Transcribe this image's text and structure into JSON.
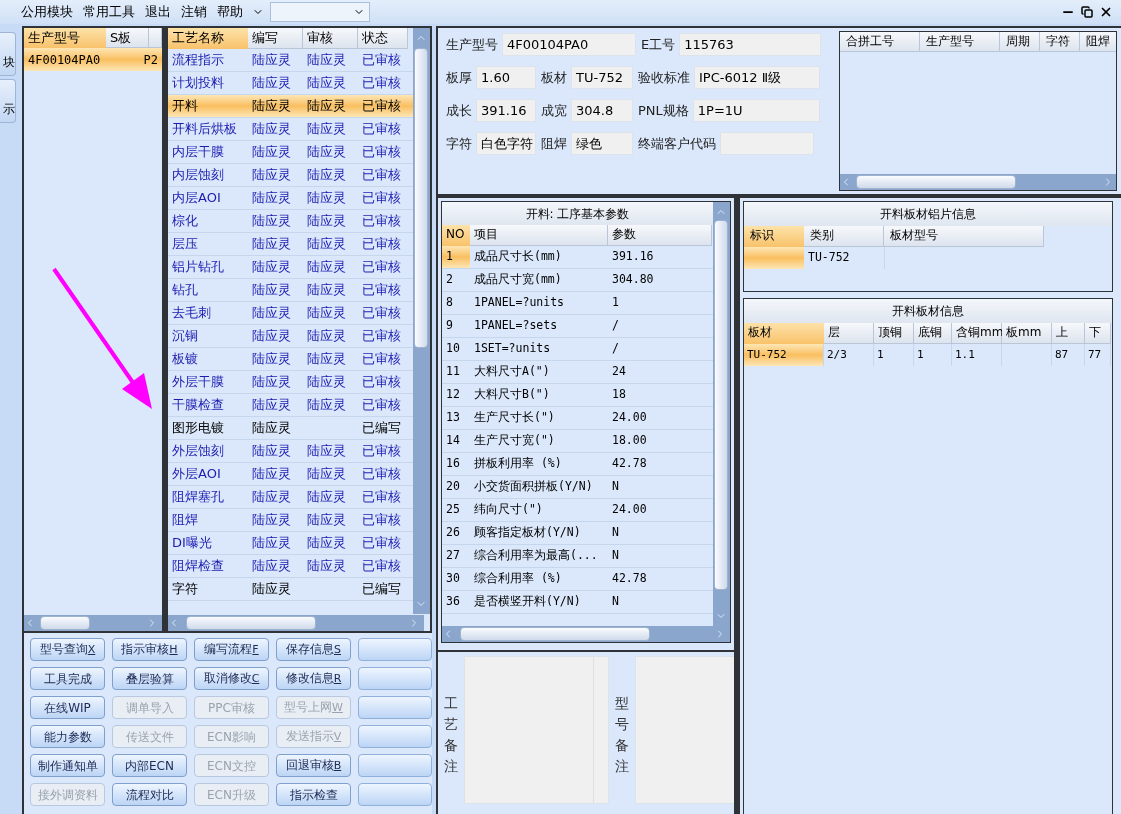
{
  "menu": {
    "items": [
      "公用模块",
      "常用工具",
      "退出",
      "注销",
      "帮助"
    ]
  },
  "left_strip": [
    "块",
    "示"
  ],
  "model_grid": {
    "columns": [
      "生产型号",
      "S板"
    ],
    "rows": [
      {
        "cells": [
          "4F00104PA0",
          "P2"
        ],
        "selected": true
      }
    ]
  },
  "process_table": {
    "columns": [
      "工艺名称",
      "编写",
      "审核",
      "状态"
    ],
    "rows": [
      {
        "name": "流程指示",
        "writer": "陆应灵",
        "reviewer": "陆应灵",
        "status": "已审核",
        "approved": true,
        "selected": false
      },
      {
        "name": "计划投料",
        "writer": "陆应灵",
        "reviewer": "陆应灵",
        "status": "已审核",
        "approved": true,
        "selected": false
      },
      {
        "name": "开料",
        "writer": "陆应灵",
        "reviewer": "陆应灵",
        "status": "已审核",
        "approved": true,
        "selected": true
      },
      {
        "name": "开料后烘板",
        "writer": "陆应灵",
        "reviewer": "陆应灵",
        "status": "已审核",
        "approved": true,
        "selected": false
      },
      {
        "name": "内层干膜",
        "writer": "陆应灵",
        "reviewer": "陆应灵",
        "status": "已审核",
        "approved": true,
        "selected": false
      },
      {
        "name": "内层蚀刻",
        "writer": "陆应灵",
        "reviewer": "陆应灵",
        "status": "已审核",
        "approved": true,
        "selected": false
      },
      {
        "name": "内层AOI",
        "writer": "陆应灵",
        "reviewer": "陆应灵",
        "status": "已审核",
        "approved": true,
        "selected": false
      },
      {
        "name": "棕化",
        "writer": "陆应灵",
        "reviewer": "陆应灵",
        "status": "已审核",
        "approved": true,
        "selected": false
      },
      {
        "name": "层压",
        "writer": "陆应灵",
        "reviewer": "陆应灵",
        "status": "已审核",
        "approved": true,
        "selected": false
      },
      {
        "name": "铝片钻孔",
        "writer": "陆应灵",
        "reviewer": "陆应灵",
        "status": "已审核",
        "approved": true,
        "selected": false
      },
      {
        "name": "钻孔",
        "writer": "陆应灵",
        "reviewer": "陆应灵",
        "status": "已审核",
        "approved": true,
        "selected": false
      },
      {
        "name": "去毛刺",
        "writer": "陆应灵",
        "reviewer": "陆应灵",
        "status": "已审核",
        "approved": true,
        "selected": false
      },
      {
        "name": "沉铜",
        "writer": "陆应灵",
        "reviewer": "陆应灵",
        "status": "已审核",
        "approved": true,
        "selected": false
      },
      {
        "name": "板镀",
        "writer": "陆应灵",
        "reviewer": "陆应灵",
        "status": "已审核",
        "approved": true,
        "selected": false
      },
      {
        "name": "外层干膜",
        "writer": "陆应灵",
        "reviewer": "陆应灵",
        "status": "已审核",
        "approved": true,
        "selected": false
      },
      {
        "name": "干膜检查",
        "writer": "陆应灵",
        "reviewer": "陆应灵",
        "status": "已审核",
        "approved": true,
        "selected": false
      },
      {
        "name": "图形电镀",
        "writer": "陆应灵",
        "status": "已编写",
        "approved": false,
        "selected": false
      },
      {
        "name": "外层蚀刻",
        "writer": "陆应灵",
        "reviewer": "陆应灵",
        "status": "已审核",
        "approved": true,
        "selected": false
      },
      {
        "name": "外层AOI",
        "writer": "陆应灵",
        "reviewer": "陆应灵",
        "status": "已审核",
        "approved": true,
        "selected": false
      },
      {
        "name": "阻焊塞孔",
        "writer": "陆应灵",
        "reviewer": "陆应灵",
        "status": "已审核",
        "approved": true,
        "selected": false
      },
      {
        "name": "阻焊",
        "writer": "陆应灵",
        "reviewer": "陆应灵",
        "status": "已审核",
        "approved": true,
        "selected": false
      },
      {
        "name": "DI曝光",
        "writer": "陆应灵",
        "reviewer": "陆应灵",
        "status": "已审核",
        "approved": true,
        "selected": false
      },
      {
        "name": "阻焊检查",
        "writer": "陆应灵",
        "reviewer": "陆应灵",
        "status": "已审核",
        "approved": true,
        "selected": false
      },
      {
        "name": "字符",
        "writer": "陆应灵",
        "status": "已编写",
        "approved": false,
        "selected": false
      }
    ]
  },
  "buttons": [
    [
      {
        "label": "型号查询",
        "shortcut": "X",
        "disabled": false
      },
      {
        "label": "指示审核",
        "shortcut": "H",
        "disabled": false
      },
      {
        "label": "编写流程",
        "shortcut": "F",
        "disabled": false
      },
      {
        "label": "保存信息",
        "shortcut": "S",
        "disabled": false
      },
      {
        "kind": "blank"
      }
    ],
    [
      {
        "label": "工具完成",
        "disabled": false
      },
      {
        "label": "叠层验算",
        "disabled": false
      },
      {
        "label": "取消修改",
        "shortcut": "C",
        "disabled": false
      },
      {
        "label": "修改信息",
        "shortcut": "R",
        "disabled": false
      },
      {
        "kind": "blank"
      }
    ],
    [
      {
        "label": "在线WIP",
        "disabled": false
      },
      {
        "label": "调单导入",
        "disabled": true
      },
      {
        "label": "PPC审核",
        "disabled": true
      },
      {
        "label": "型号上网",
        "shortcut": "W",
        "disabled": true
      },
      {
        "kind": "blank"
      }
    ],
    [
      {
        "label": "能力参数",
        "disabled": false
      },
      {
        "label": "传送文件",
        "disabled": true
      },
      {
        "label": "ECN影响",
        "disabled": true
      },
      {
        "label": "发送指示",
        "shortcut": "V",
        "disabled": true
      },
      {
        "kind": "blank"
      }
    ],
    [
      {
        "label": "制作通知单",
        "disabled": false
      },
      {
        "label": "内部ECN",
        "disabled": false
      },
      {
        "label": "ECN文控",
        "disabled": true
      },
      {
        "label": "回退审核",
        "shortcut": "B",
        "disabled": false
      },
      {
        "kind": "blank"
      }
    ],
    [
      {
        "label": "接外调资料",
        "disabled": true
      },
      {
        "label": "流程对比",
        "disabled": false
      },
      {
        "label": "ECN升级",
        "disabled": true
      },
      {
        "label": "指示检查",
        "disabled": false
      },
      {
        "kind": "blank"
      }
    ]
  ],
  "info": {
    "fields": [
      {
        "label": "生产型号",
        "value": "4F00104PA0"
      },
      {
        "label": "E工号",
        "value": "115763"
      },
      {
        "label": "板厚",
        "value": "1.60"
      },
      {
        "label": "板材",
        "value": "TU-752"
      },
      {
        "label": "验收标准",
        "value": "IPC-6012 Ⅱ级"
      },
      {
        "label": "成长",
        "value": "391.16"
      },
      {
        "label": "成宽",
        "value": "304.8"
      },
      {
        "label": "PNL规格",
        "value": "1P=1U"
      },
      {
        "label": "字符",
        "value": "白色字符"
      },
      {
        "label": "阻焊",
        "value": "绿色"
      },
      {
        "label": "终端客户代码"
      }
    ]
  },
  "merge_table": {
    "columns": [
      "合拼工号",
      "生产型号",
      "周期",
      "字符",
      "阻焊"
    ]
  },
  "params": {
    "title": "开料: 工序基本参数",
    "columns": [
      "NO",
      "项目",
      "参数"
    ],
    "rows": [
      {
        "no": "1",
        "item": "成品尺寸长(mm)",
        "value": "391.16",
        "selected": true
      },
      {
        "no": "2",
        "item": "成品尺寸宽(mm)",
        "value": "304.80",
        "selected": false
      },
      {
        "no": "8",
        "item": "1PANEL=?units",
        "value": "1",
        "selected": false
      },
      {
        "no": "9",
        "item": "1PANEL=?sets",
        "value": "/",
        "selected": false
      },
      {
        "no": "10",
        "item": "1SET=?units",
        "value": "/",
        "selected": false
      },
      {
        "no": "11",
        "item": "大料尺寸A(\")",
        "value": "24",
        "selected": false
      },
      {
        "no": "12",
        "item": "大料尺寸B(\")",
        "value": "18",
        "selected": false
      },
      {
        "no": "13",
        "item": "生产尺寸长(\")",
        "value": "24.00",
        "selected": false
      },
      {
        "no": "14",
        "item": "生产尺寸宽(\")",
        "value": "18.00",
        "selected": false
      },
      {
        "no": "16",
        "item": "拼板利用率 (%)",
        "value": "42.78",
        "selected": false
      },
      {
        "no": "20",
        "item": "小交货面积拼板(Y/N)",
        "value": "N",
        "selected": false
      },
      {
        "no": "25",
        "item": "纬向尺寸(\")",
        "value": "24.00",
        "selected": false
      },
      {
        "no": "26",
        "item": "顾客指定板材(Y/N)",
        "value": "N",
        "selected": false
      },
      {
        "no": "27",
        "item": "综合利用率为最高(...",
        "value": "N",
        "selected": false
      },
      {
        "no": "30",
        "item": "综合利用率 (%)",
        "value": "42.78",
        "selected": false
      },
      {
        "no": "36",
        "item": "是否横竖开料(Y/N)",
        "value": "N",
        "selected": false
      }
    ]
  },
  "aluminum": {
    "title": "开料板材铝片信息",
    "columns": [
      "标识",
      "类别",
      "板材型号"
    ],
    "rows": [
      {
        "category": "TU-752",
        "selected": true
      }
    ]
  },
  "board": {
    "title": "开料板材信息",
    "columns": [
      "板材",
      "层",
      "顶铜",
      "底铜",
      "含铜mm",
      "板mm",
      "上",
      "下"
    ],
    "rows": [
      {
        "cells": [
          "TU-752",
          "2/3",
          "1",
          "1",
          "1.1",
          null,
          "87",
          "77"
        ],
        "selected": true
      }
    ]
  },
  "remarks": [
    {
      "label": "工艺备注"
    },
    {
      "label": "型号备注"
    }
  ]
}
